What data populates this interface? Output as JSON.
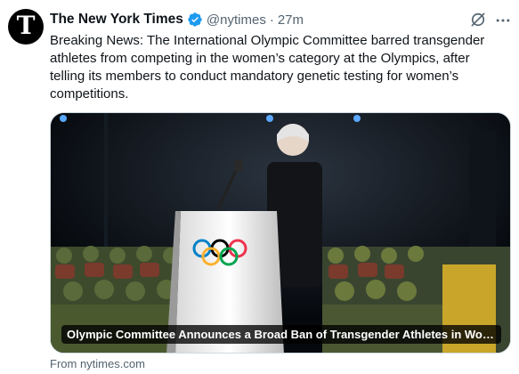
{
  "tweet": {
    "author": {
      "avatar_glyph": "T",
      "display_name": "The New York Times",
      "verified": true,
      "handle": "@nytimes",
      "separator": "·",
      "time": "27m"
    },
    "icons": {
      "grok": "grok-icon",
      "more": "more-icon",
      "verified": "verified-badge-icon"
    },
    "text": "Breaking News: The International Olympic Committee barred transgender athletes from competing in the women’s category at the Olympics, after telling its members to conduct mandatory genetic testing for women’s competitions.",
    "card": {
      "caption": "Olympic Committee Announces a Broad Ban of Transgender Athletes in Wome...",
      "image_alt": "Speaker at podium with Olympic rings logo in front of seated audience"
    },
    "source": "From nytimes.com"
  },
  "colors": {
    "text": "#0f1419",
    "secondary": "#536471",
    "verified": "#1d9bf0",
    "border": "#cfd9de"
  }
}
